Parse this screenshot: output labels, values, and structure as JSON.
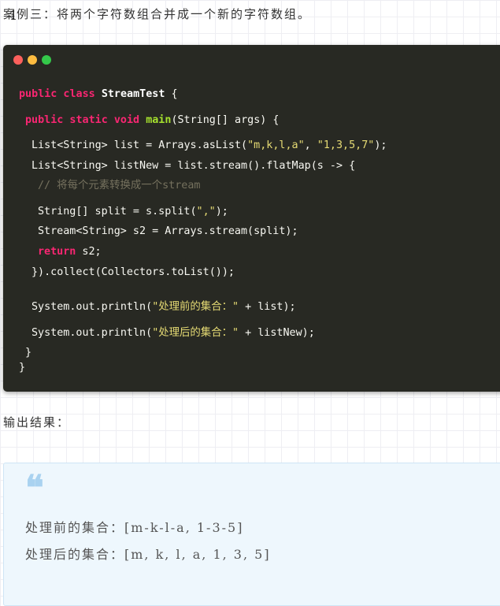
{
  "intro": {
    "text": "案例三：将两个字符数组合并成一个新的字符数组。",
    "line_number": "1"
  },
  "code_window": {
    "dot_colors": [
      "#fc605c",
      "#fdbc40",
      "#34c84a"
    ],
    "lines": [
      {
        "segments": [
          {
            "t": "public class ",
            "c": "kw"
          },
          {
            "t": "StreamTest",
            "c": "cls"
          },
          {
            "t": " {",
            "c": "plain"
          }
        ]
      },
      {
        "segments": [
          {
            "t": "public static void ",
            "c": "kw"
          },
          {
            "t": "main",
            "c": "fn"
          },
          {
            "t": "(String[] args) {",
            "c": "plain"
          }
        ]
      },
      {
        "segments": [
          {
            "t": "List<String> list = Arrays.asList(",
            "c": "plain"
          },
          {
            "t": "\"m,k,l,a\"",
            "c": "str"
          },
          {
            "t": ", ",
            "c": "plain"
          },
          {
            "t": "\"1,3,5,7\"",
            "c": "str"
          },
          {
            "t": ");",
            "c": "plain"
          }
        ]
      },
      {
        "segments": [
          {
            "t": "List<String> listNew = list.stream().flatMap(s -> {",
            "c": "plain"
          }
        ]
      },
      {
        "segments": [
          {
            "t": "// 将每个元素转换成一个stream",
            "c": "cm"
          }
        ]
      },
      {
        "segments": [
          {
            "t": "String[] split = s.split(",
            "c": "plain"
          },
          {
            "t": "\",\"",
            "c": "str"
          },
          {
            "t": ");",
            "c": "plain"
          }
        ]
      },
      {
        "segments": [
          {
            "t": "Stream<String> s2 = Arrays.stream(split);",
            "c": "plain"
          }
        ]
      },
      {
        "segments": [
          {
            "t": "return",
            "c": "kw"
          },
          {
            "t": " s2;",
            "c": "plain"
          }
        ]
      },
      {
        "segments": [
          {
            "t": "}).collect(Collectors.toList());",
            "c": "plain"
          }
        ]
      },
      {
        "segments": [
          {
            "t": "System.out.println(",
            "c": "plain"
          },
          {
            "t": "\"处理前的集合：\"",
            "c": "str"
          },
          {
            "t": " + list);",
            "c": "plain"
          }
        ]
      },
      {
        "segments": [
          {
            "t": "System.out.println(",
            "c": "plain"
          },
          {
            "t": "\"处理后的集合：\"",
            "c": "str"
          },
          {
            "t": " + listNew);",
            "c": "plain"
          }
        ]
      },
      {
        "segments": [
          {
            "t": "}",
            "c": "plain"
          }
        ]
      },
      {
        "segments": [
          {
            "t": "}",
            "c": "plain"
          }
        ]
      }
    ]
  },
  "output_heading": "输出结果：",
  "result": {
    "quote_icon": "quote-icon",
    "line1": "处理前的集合：[m-k-l-a, 1-3-5]",
    "line2": "处理后的集合：[m, k, l, a, 1, 3, 5]"
  }
}
